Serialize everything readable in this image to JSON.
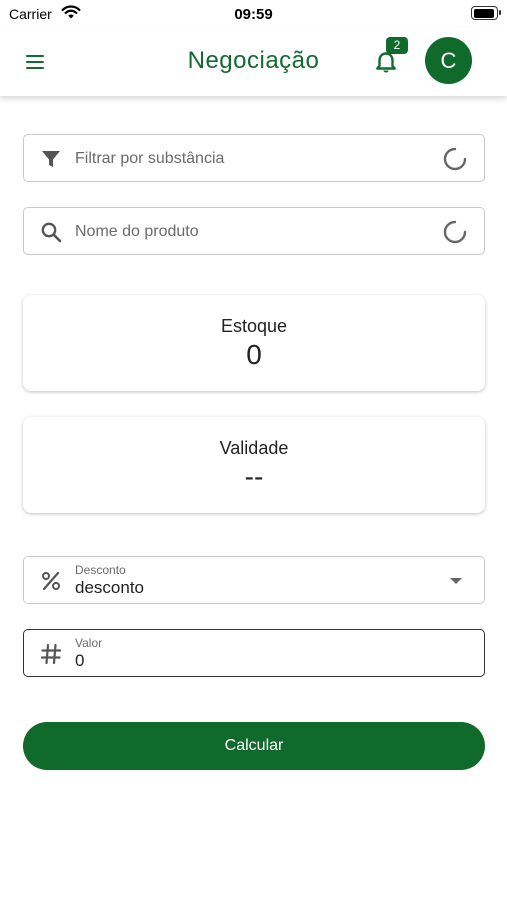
{
  "status_bar": {
    "carrier": "Carrier",
    "time": "09:59",
    "battery_level": 0.95
  },
  "app_bar": {
    "title": "Negociação",
    "notification_count": "2",
    "avatar_initial": "C"
  },
  "filters": {
    "substance_placeholder": "Filtrar por substância",
    "product_placeholder": "Nome do produto"
  },
  "cards": {
    "stock": {
      "label": "Estoque",
      "value": "0"
    },
    "validity": {
      "label": "Validade",
      "value": "--"
    }
  },
  "form": {
    "discount": {
      "label": "Desconto",
      "value": "desconto"
    },
    "amount": {
      "label": "Valor",
      "value": "0"
    }
  },
  "actions": {
    "calculate_label": "Calcular"
  },
  "icons": {
    "menu": "hamburger-icon",
    "bell": "bell-icon",
    "filter": "filter-icon",
    "search": "search-icon",
    "loading": "spinner-icon",
    "percent": "percent-icon",
    "hash": "hash-icon"
  },
  "colors": {
    "primary": "#0f6a2c",
    "title": "#126b30"
  }
}
